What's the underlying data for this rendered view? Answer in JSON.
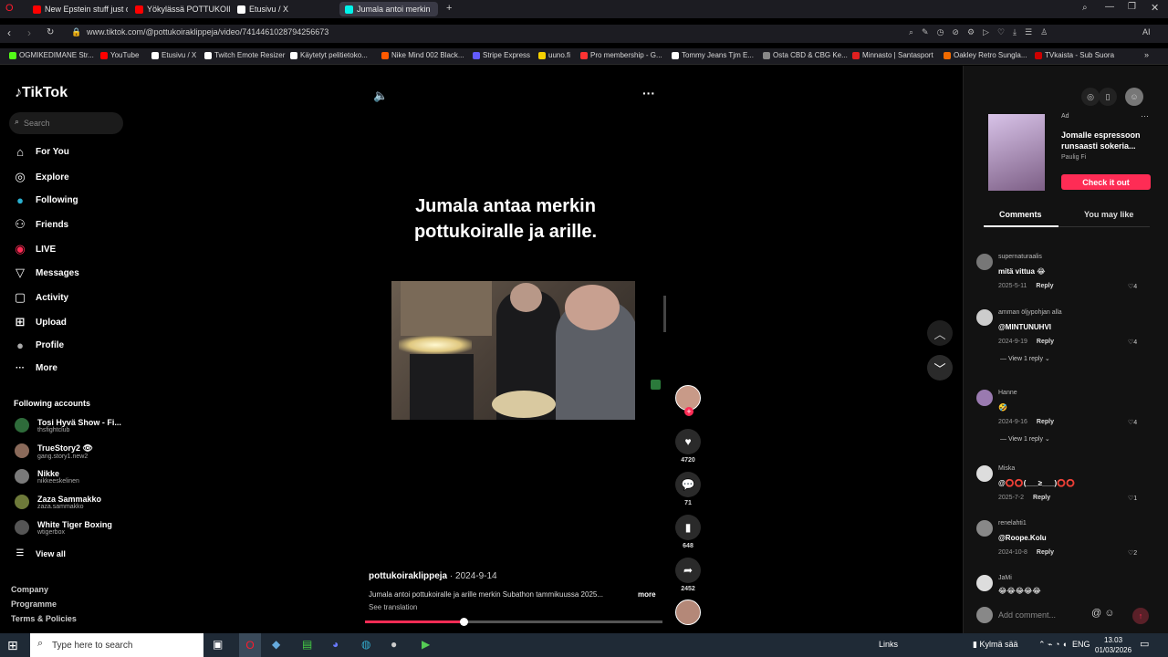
{
  "browser": {
    "tabs": [
      {
        "label": "New Epstein stuff just dr",
        "color": "#ff0000"
      },
      {
        "label": "Yökylässä POTTUKOIRAN",
        "color": "#ff0000"
      },
      {
        "label": "Etusivu / X",
        "color": "#ffffff"
      },
      {
        "label": "Jumala antoi merkin",
        "color": "#00f2ea"
      }
    ],
    "url": "www.tiktok.com/@pottukoiraklippeja/video/7414461028794256673",
    "bookmarks": [
      {
        "label": "OGMIKEDIMANE Str...",
        "color": "#53fc18"
      },
      {
        "label": "YouTube",
        "color": "#ff0000"
      },
      {
        "label": "Etusivu / X",
        "color": "#ffffff"
      },
      {
        "label": "Twitch Emote Resizer",
        "color": "#ffffff"
      },
      {
        "label": "Käytetyt pelitietoko...",
        "color": "#ffffff"
      },
      {
        "label": "Nike Mind 002 Black...",
        "color": "#ff5a00"
      },
      {
        "label": "Stripe Express",
        "color": "#635bff"
      },
      {
        "label": "uuno.fi",
        "color": "#f5d000"
      },
      {
        "label": "Pro membership - G...",
        "color": "#ff3333"
      },
      {
        "label": "Tommy Jeans Tjm E...",
        "color": "#ffffff"
      },
      {
        "label": "Osta CBD & CBG Ke...",
        "color": "#888888"
      },
      {
        "label": "Minnasto | Santasport",
        "color": "#e02020"
      },
      {
        "label": "Oakley Retro Sungla...",
        "color": "#f06a00"
      },
      {
        "label": "TVkaista - Sub Suora",
        "color": "#cc0000"
      }
    ]
  },
  "sidebar": {
    "logo": "TikTok",
    "search_placeholder": "Search",
    "nav": [
      {
        "label": "For You",
        "icon": "home-icon",
        "glyph": "⌂"
      },
      {
        "label": "Explore",
        "icon": "compass-icon",
        "glyph": "◎"
      },
      {
        "label": "Following",
        "icon": "following-icon",
        "glyph": "●"
      },
      {
        "label": "Friends",
        "icon": "friends-icon",
        "glyph": "⚇"
      },
      {
        "label": "LIVE",
        "icon": "live-icon",
        "glyph": "◉"
      },
      {
        "label": "Messages",
        "icon": "messages-icon",
        "glyph": "▽"
      },
      {
        "label": "Activity",
        "icon": "activity-icon",
        "glyph": "▢"
      },
      {
        "label": "Upload",
        "icon": "upload-icon",
        "glyph": "⊞"
      },
      {
        "label": "Profile",
        "icon": "profile-icon",
        "glyph": "●"
      },
      {
        "label": "More",
        "icon": "more-icon",
        "glyph": "···"
      }
    ],
    "following_title": "Following accounts",
    "accounts": [
      {
        "name": "Tosi Hyvä Show - Fi...",
        "handle": "thsfightclub"
      },
      {
        "name": "TrueStory2 👁",
        "handle": "gang.story1.new2"
      },
      {
        "name": "Nikke",
        "handle": "nikkeeskelinen"
      },
      {
        "name": "Zaza Sammakko",
        "handle": "zaza.sammakko"
      },
      {
        "name": "White Tiger Boxing",
        "handle": "wtigerbox"
      }
    ],
    "view_all": "View all",
    "footer": [
      "Company",
      "Programme",
      "Terms & Policies"
    ]
  },
  "video": {
    "caption_line1": "Jumala antaa merkin",
    "caption_line2": "pottukoiralle ja arille.",
    "author": "pottukoiraklippeja",
    "date": " · 2024-9-14",
    "description": "Jumala antoi pottukoiralle ja arille merkin Subathon tammikuussa 2025...",
    "more": "more",
    "see_translation": "See translation",
    "progress": 0.33,
    "likes": "4720",
    "comments": "71",
    "saves": "648",
    "shares": "2452"
  },
  "ad": {
    "label": "Ad",
    "title": "Jomalle espressoon runsaasti sokeria...",
    "by": "Paulig Fi",
    "cta": "Check it out"
  },
  "tabs": {
    "comments": "Comments",
    "you_may_like": "You may like"
  },
  "comments": [
    {
      "user": "supernaturaalis",
      "text": "mitä vittua 😂",
      "date": "2025-5-11",
      "reply": "Reply",
      "likes": "4",
      "replies": ""
    },
    {
      "user": "amman öljypohjan alla",
      "text": "@MINTUNUHVI",
      "date": "2024-9-19",
      "reply": "Reply",
      "likes": "4",
      "replies": "View 1 reply"
    },
    {
      "user": "Hanne",
      "text": "🤣",
      "date": "2024-9-16",
      "reply": "Reply",
      "likes": "4",
      "replies": "View 1 reply"
    },
    {
      "user": "Miska",
      "text": "@⭕⭕(___≥___)⭕⭕",
      "date": "2025-7-2",
      "reply": "Reply",
      "likes": "1",
      "replies": ""
    },
    {
      "user": "renelahti1",
      "text": "@Roope.Kolu",
      "date": "2024-10-8",
      "reply": "Reply",
      "likes": "2",
      "replies": ""
    },
    {
      "user": "JaMi",
      "text": "😂😂😂😂😂",
      "date": "",
      "reply": "",
      "likes": "",
      "replies": ""
    }
  ],
  "add_comment_placeholder": "Add comment...",
  "taskbar": {
    "search_placeholder": "Type here to search",
    "links": "Links",
    "weather": "Kylmä sää",
    "lang": "ENG",
    "time": "13.03",
    "date": "01/03/2026"
  }
}
